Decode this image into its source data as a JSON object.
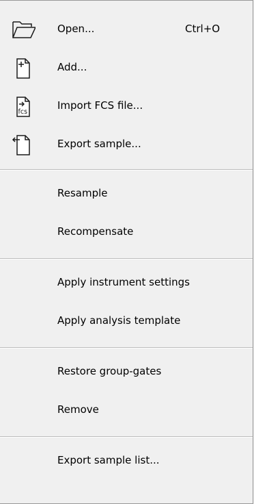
{
  "menu": {
    "items": [
      {
        "label": "Open...",
        "shortcut": "Ctrl+O",
        "icon": "folder-open-icon"
      },
      {
        "label": "Add...",
        "icon": "add-document-icon"
      },
      {
        "label": "Import FCS file...",
        "icon": "import-fcs-icon",
        "icon_text": "fcs"
      },
      {
        "label": "Export sample...",
        "icon": "export-document-icon"
      },
      {
        "label": "Resample"
      },
      {
        "label": "Recompensate"
      },
      {
        "label": "Apply instrument settings"
      },
      {
        "label": "Apply analysis template"
      },
      {
        "label": "Restore group-gates"
      },
      {
        "label": "Remove"
      },
      {
        "label": "Export sample list..."
      }
    ]
  }
}
